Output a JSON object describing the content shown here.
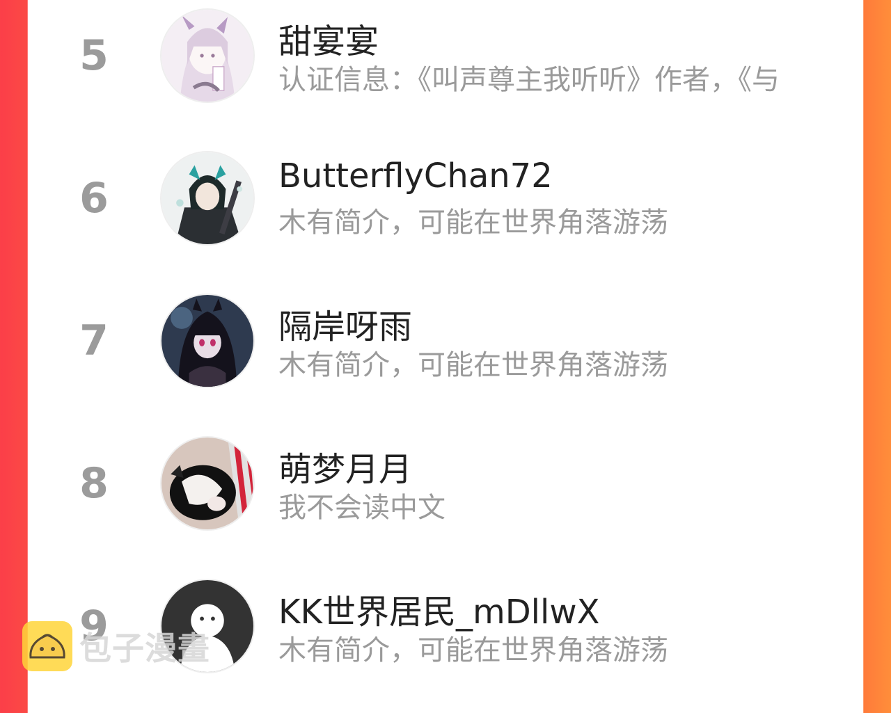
{
  "list": {
    "items": [
      {
        "rank": "5",
        "name": "甜宴宴",
        "bio": "认证信息：《叫声尊主我听听》作者，《与",
        "avatar_icon": "anime-girl-avatar-icon"
      },
      {
        "rank": "6",
        "name": "ButterflyChan72",
        "bio": "木有简介，可能在世界角落游荡",
        "avatar_icon": "anime-boy-avatar-icon"
      },
      {
        "rank": "7",
        "name": "隔岸呀雨",
        "bio": "木有简介，可能在世界角落游荡",
        "avatar_icon": "dark-hair-girl-avatar-icon"
      },
      {
        "rank": "8",
        "name": "萌梦月月",
        "bio": "我不会读中文",
        "avatar_icon": "cat-photo-avatar-icon"
      },
      {
        "rank": "9",
        "name": "KK世界居民_mDllwX",
        "bio": "木有简介，可能在世界角落游荡",
        "avatar_icon": "default-ghost-avatar-icon"
      }
    ]
  },
  "watermark": {
    "text": "包子漫畫",
    "icon": "bun-logo-icon"
  },
  "colors": {
    "left_border": "#fb3e49",
    "right_border": "#ff8e3a",
    "rank": "#9b9b9b",
    "bio": "#9a9a9a"
  }
}
